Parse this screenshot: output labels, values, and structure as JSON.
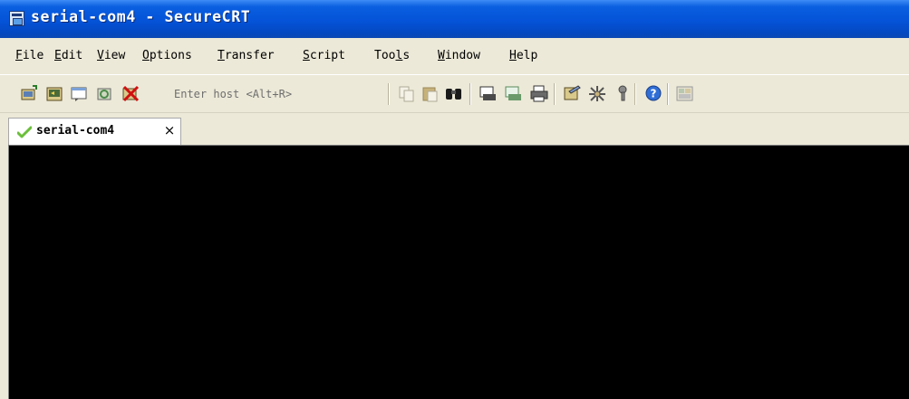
{
  "window": {
    "title": "serial-com4 - SecureCRT",
    "title_bar_color": "#0553d8"
  },
  "menu": {
    "items": [
      {
        "label": "File",
        "mnemonic": "F"
      },
      {
        "label": "Edit",
        "mnemonic": "E"
      },
      {
        "label": "View",
        "mnemonic": "V"
      },
      {
        "label": "Options",
        "mnemonic": "O"
      },
      {
        "label": "Transfer",
        "mnemonic": "T"
      },
      {
        "label": "Script",
        "mnemonic": "S"
      },
      {
        "label": "Tools",
        "mnemonic": "l"
      },
      {
        "label": "Window",
        "mnemonic": "W"
      },
      {
        "label": "Help",
        "mnemonic": "H"
      }
    ]
  },
  "toolbar": {
    "host_placeholder": "Enter host <Alt+R>",
    "icons": [
      "connect-icon",
      "quick-connect-icon",
      "connect-in-tab-icon",
      "reconnect-icon",
      "disconnect-icon",
      "copy-icon",
      "paste-icon",
      "find-icon",
      "print-screen-icon",
      "print-selection-icon",
      "print-icon",
      "session-options-icon",
      "global-options-icon",
      "key-icon",
      "help-icon",
      "keymap-icon"
    ]
  },
  "tabs": [
    {
      "label": "serial-com4",
      "status": "connected",
      "close": "×"
    }
  ],
  "terminal": {
    "background": "#000000",
    "content": ""
  }
}
